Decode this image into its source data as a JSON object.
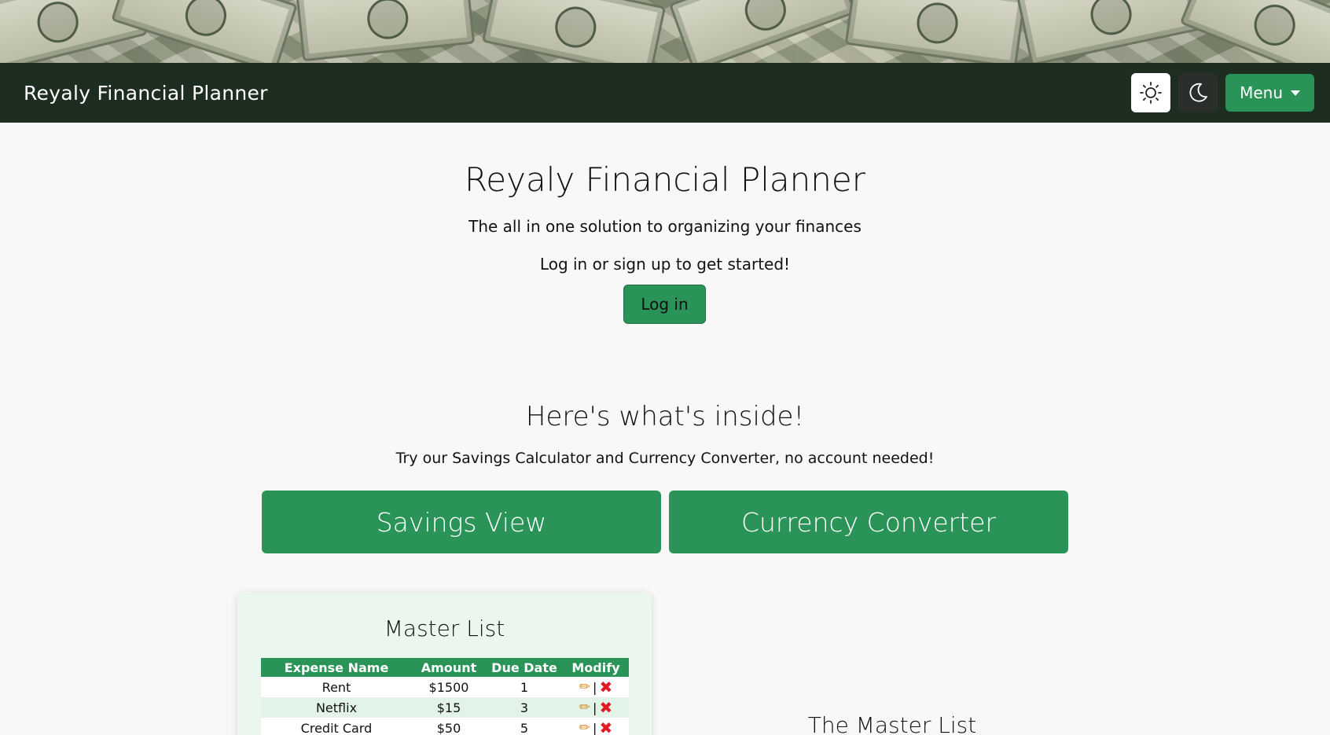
{
  "navbar": {
    "brand": "Reyaly Financial Planner",
    "light_icon": "sun-icon",
    "dark_icon": "moon-icon",
    "menu_label": "Menu"
  },
  "hero": {
    "title": "Reyaly Financial Planner",
    "subtitle": "The all in one solution to organizing your finances",
    "cta_text": "Log in or sign up to get started!",
    "login_label": "Log in"
  },
  "features": {
    "title": "Here's what's inside!",
    "subtitle": "Try our Savings Calculator and Currency Converter, no account needed!",
    "savings_label": "Savings View",
    "converter_label": "Currency Converter"
  },
  "master_list": {
    "title": "Master List",
    "headers": [
      "Expense Name",
      "Amount",
      "Due Date",
      "Modify"
    ],
    "rows": [
      {
        "name": "Rent",
        "amount": "$1500",
        "due": "1",
        "sep": "|"
      },
      {
        "name": "Netflix",
        "amount": "$15",
        "due": "3",
        "sep": "|"
      },
      {
        "name": "Credit Card",
        "amount": "$50",
        "due": "5",
        "sep": "|"
      }
    ]
  },
  "section_heading": "The Master List",
  "colors": {
    "navbar": "#1d2d1f",
    "accent_green": "#2a9358",
    "card_bg": "#eaf6ee",
    "delete_red": "#e01b24"
  }
}
